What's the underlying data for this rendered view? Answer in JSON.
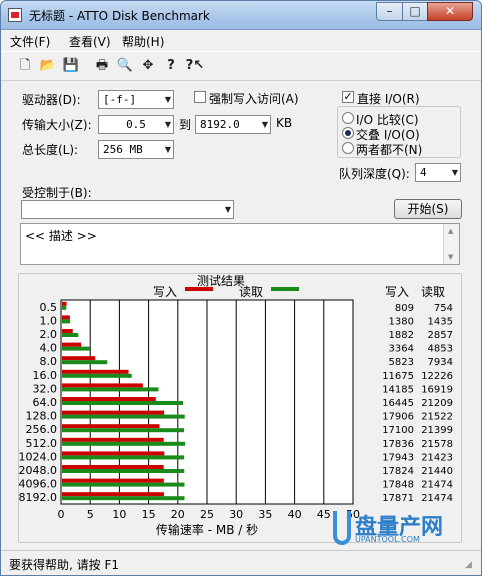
{
  "window": {
    "title": "无标题 - ATTO Disk Benchmark",
    "min": "–",
    "max": "□",
    "close": "✕"
  },
  "menu": [
    {
      "label": "文件(F)"
    },
    {
      "label": "查看(V)"
    },
    {
      "label": "帮助(H)"
    }
  ],
  "toolbar": [
    {
      "name": "new-icon",
      "glyph": "🗋"
    },
    {
      "name": "open-icon",
      "glyph": "📂"
    },
    {
      "name": "save-icon",
      "glyph": "💾"
    },
    {
      "name": "print-icon",
      "glyph": "🖶"
    },
    {
      "name": "print-preview-icon",
      "glyph": "🔍"
    },
    {
      "name": "move-icon",
      "glyph": "✥"
    },
    {
      "name": "help-icon",
      "glyph": "?"
    },
    {
      "name": "context-help-icon",
      "glyph": "?↖"
    }
  ],
  "settings": {
    "drive_label": "驱动器(D):",
    "drive_value": "[-f-]",
    "force_write_label": "强制写入访问(A)",
    "transfer_label": "传输大小(Z):",
    "transfer_from": "0.5",
    "transfer_to_label": "到",
    "transfer_to": "8192.0",
    "transfer_unit": "KB",
    "total_label": "总长度(L):",
    "total_value": "256 MB",
    "direct_io_label": "直接 I/O(R)",
    "io_compare": "I/O 比较(C)",
    "overlap_io": "交叠 I/O(O)",
    "neither": "两者都不(N)",
    "queue_label": "队列深度(Q):",
    "queue_value": "4",
    "controlled_label": "受控制于(B):",
    "controlled_value": "",
    "start_button": "开始(S)",
    "description": "<< 描述 >>"
  },
  "chart_data": {
    "type": "bar",
    "title": "测试结果",
    "legend": [
      {
        "name": "写入",
        "color": "#cc0000"
      },
      {
        "name": "读取",
        "color": "#1a8a1a"
      }
    ],
    "xlabel": "传输速率 - MB / 秒",
    "xlim": [
      0,
      50
    ],
    "xticks": [
      "0",
      "5",
      "10",
      "15",
      "20",
      "25",
      "30",
      "35",
      "40",
      "45",
      "50"
    ],
    "categories": [
      "0.5",
      "1.0",
      "2.0",
      "4.0",
      "8.0",
      "16.0",
      "32.0",
      "64.0",
      "128.0",
      "256.0",
      "512.0",
      "1024.0",
      "2048.0",
      "4096.0",
      "8192.0"
    ],
    "col_write": "写入",
    "col_read": "读取",
    "series": [
      {
        "name": "写入",
        "color": "#cc0000",
        "values": [
          809,
          1380,
          1882,
          3364,
          5823,
          11675,
          14185,
          16445,
          17906,
          17100,
          17836,
          17943,
          17824,
          17848,
          17871
        ]
      },
      {
        "name": "读取",
        "color": "#1a8a1a",
        "values": [
          754,
          1435,
          2857,
          4853,
          7934,
          12226,
          16919,
          21209,
          21522,
          21399,
          21578,
          21423,
          21440,
          21474,
          21474
        ]
      }
    ]
  },
  "status": "要获得帮助, 请按 F1",
  "watermark": {
    "main": "盘量产网",
    "sub": "UPANTOOL.COM"
  }
}
